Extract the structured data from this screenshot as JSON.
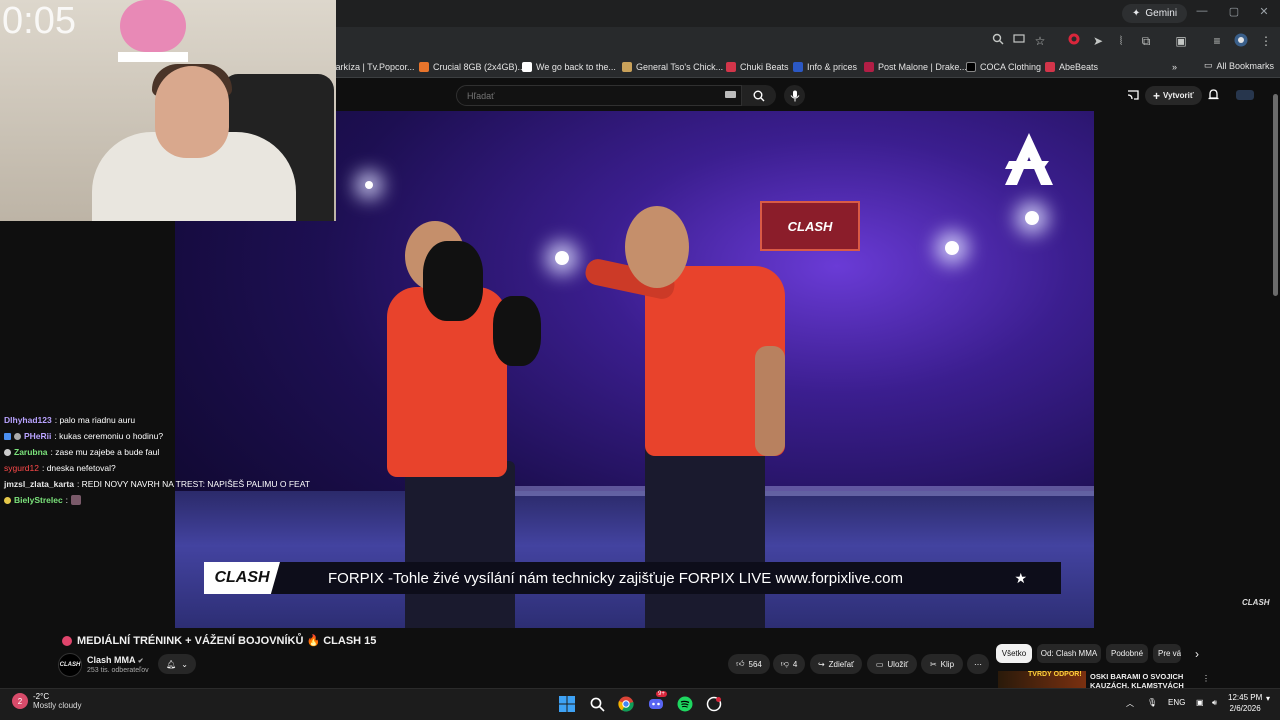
{
  "browser": {
    "gemini_label": "Gemini",
    "bookmarks": [
      {
        "label": "Markíza | Tv.Popcor...",
        "color": "#1e6bd6"
      },
      {
        "label": "Crucial 8GB (2x4GB)...",
        "color": "#e8742b"
      },
      {
        "label": "We go back to the...",
        "color": "#4285f4"
      },
      {
        "label": "General Tso's Chick...",
        "color": "#c9a15a"
      },
      {
        "label": "Chuki Beats",
        "color": "#d3354a"
      },
      {
        "label": "Info & prices",
        "color": "#2b58c4"
      },
      {
        "label": "Post Malone | Drake...",
        "color": "#b21e45"
      },
      {
        "label": "COCA Clothing",
        "color": "#000000"
      },
      {
        "label": "AbeBeats",
        "color": "#d3354a"
      }
    ],
    "all_bookmarks": "All Bookmarks"
  },
  "youtube": {
    "search_placeholder": "Hľadať",
    "create_label": "Vytvoriť"
  },
  "stream": {
    "timer": "0:05",
    "chat": [
      {
        "user": "Dlhyhad123",
        "user_color": "#b9a3ff",
        "msg": ": palo ma riadnu auru",
        "badges": []
      },
      {
        "user": "PHeRii",
        "user_color": "#b9a3ff",
        "msg": ": kukas ceremoniu o hodinu?",
        "badges": [
          "#4a8ef0",
          "#aaaaaa"
        ]
      },
      {
        "user": "Zarubna",
        "user_color": "#7be37b",
        "msg": ": zase mu zajebe a bude faul",
        "badges": [
          "#cccccc"
        ]
      },
      {
        "user": "sygurd12",
        "user_color": "#ff4a4a",
        "msg": ": dneska nefetoval?",
        "badges": []
      },
      {
        "user": "jmzsl_zlata_karta",
        "user_color": "#e8e8e8",
        "msg": ": REDI NOVY NAVRH NA TREST: NAPIŠEŠ PALIMU O FEAT",
        "badges": []
      },
      {
        "user": "BielyStrelec",
        "user_color": "#7be37b",
        "msg": ":",
        "badges": [
          "#e6c84a"
        ]
      }
    ]
  },
  "video": {
    "scoreboard_text": "CLASH",
    "ad_logo": "CLASH",
    "ad_text": "FORPIX -Tohle živé vysílání nám technicky zajišťuje FORPIX LIVE www.forpixlive.com",
    "watermark": "CLASH",
    "title": "MEDIÁLNÍ TRÉNINK + VÁŽENÍ BOJOVNÍKŮ 🔥 CLASH 15",
    "channel_name": "Clash MMA",
    "channel_avatar_text": "CLASH",
    "subscribers": "253 tis. odberateľov",
    "likes": "564",
    "dislikes": "4",
    "share_label": "Zdieľať",
    "save_label": "Uložiť",
    "clip_label": "Klip"
  },
  "recommendations": {
    "chips": [
      "Všetko",
      "Od: Clash MMA",
      "Podobné",
      "Pre vás"
    ],
    "first_title": "OSKI BARAMI O SVOJICH KAUZÁCH, KLAMSTVÁCH",
    "first_thumb_text": "TVRDÝ ODPOR!"
  },
  "taskbar": {
    "temp": "-2°C",
    "weather_desc": "Mostly cloudy",
    "weather_badge": "2",
    "lang": "ENG",
    "time": "12:45 PM",
    "date": "2/6/2026",
    "chrome_badge": "9+"
  }
}
